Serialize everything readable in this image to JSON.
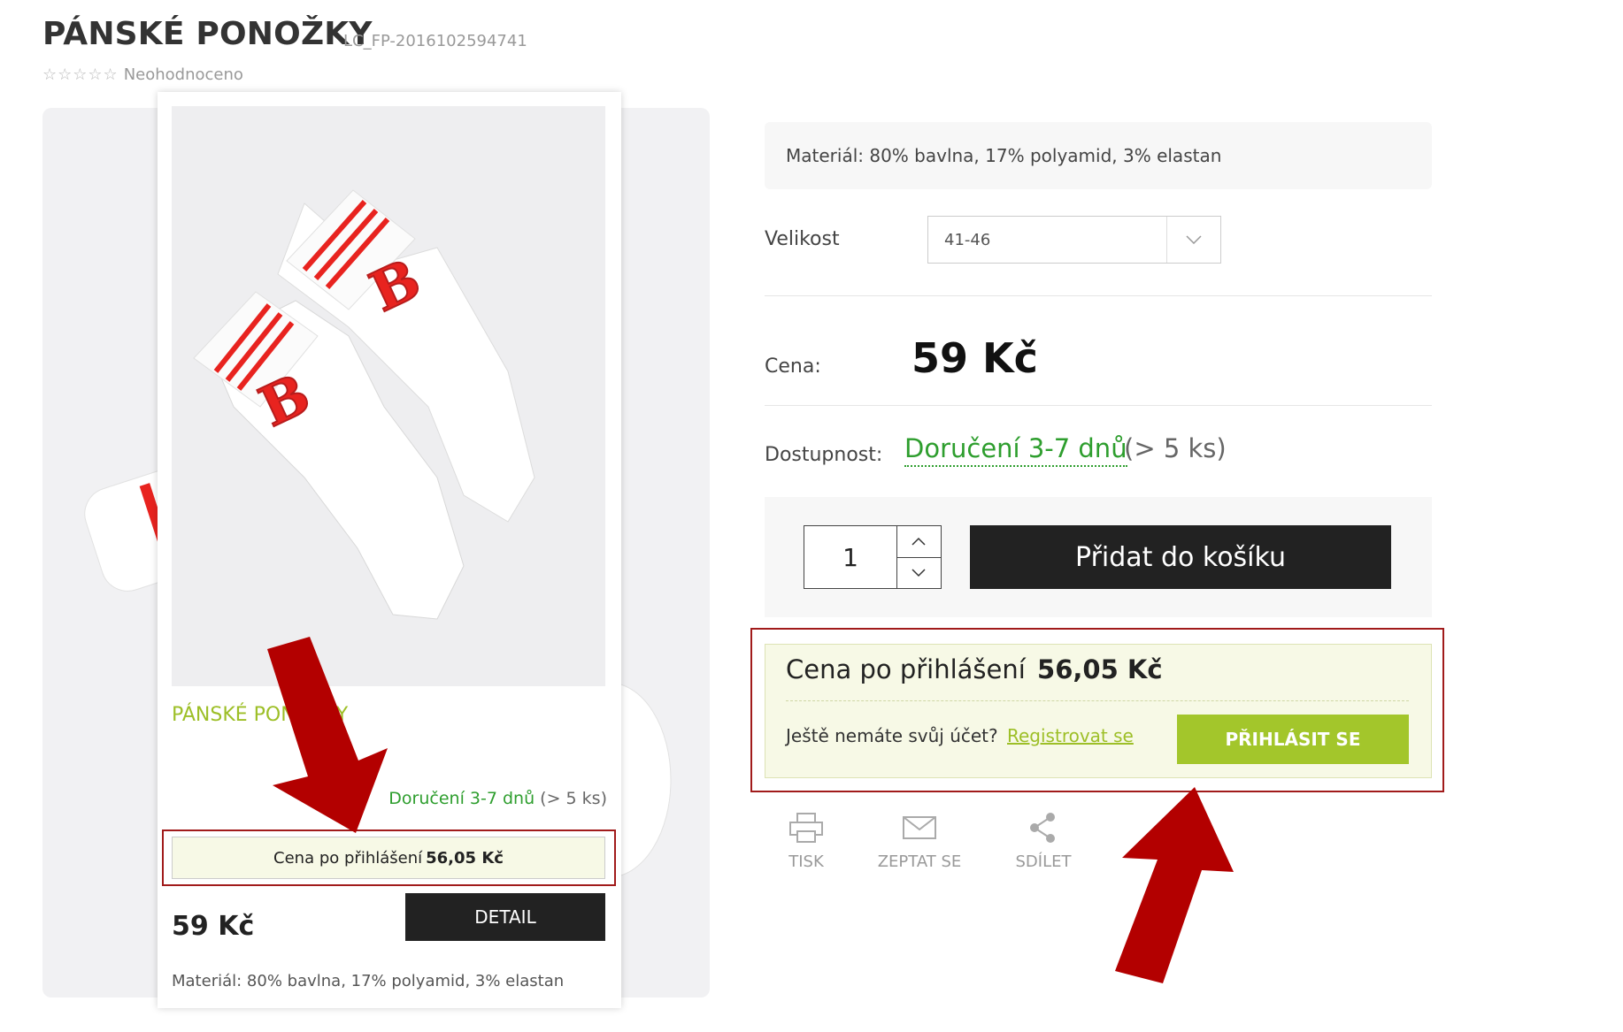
{
  "product": {
    "title": "PÁNSKÉ PONOŽKY",
    "code": "LC_FP-2016102594741",
    "rating_text": "Neohodnoceno"
  },
  "card": {
    "name": "PÁNSKÉ PONOŽKY",
    "availability": "Doručení 3-7 dnů",
    "availability_count": "(> 5 ks)",
    "login_price_label": "Cena po přihlášení",
    "login_price_value": "56,05  Kč",
    "price": "59 Kč",
    "detail_button": "DETAIL",
    "material": "Materiál: 80% bavlna, 17% polyamid, 3% elastan"
  },
  "details": {
    "material": "Materiál: 80% bavlna, 17% polyamid, 3% elastan",
    "size_label": "Velikost",
    "size_value": "41-46",
    "price_label": "Cena:",
    "price": "59 Kč",
    "availability_label": "Dostupnost:",
    "availability": "Doručení 3-7 dnů",
    "availability_count": "(> 5 ks)",
    "quantity": "1",
    "add_to_cart": "Přidat do košíku",
    "login_price_label": "Cena po přihlášení",
    "login_price_value": "56,05 Kč",
    "no_account": "Ještě nemáte svůj účet?",
    "register_link": "Registrovat se",
    "login_button": "PŘIHLÁSIT SE"
  },
  "actions": [
    {
      "label": "TISK",
      "icon": "print-icon"
    },
    {
      "label": "ZEPTAT SE",
      "icon": "mail-icon"
    },
    {
      "label": "SDÍLET",
      "icon": "share-icon"
    }
  ],
  "colors": {
    "accent_green": "#a3c62b",
    "availability_green": "#2e9e2e",
    "highlight_red": "#a11b1b",
    "annotation_arrow": "#b30000"
  }
}
